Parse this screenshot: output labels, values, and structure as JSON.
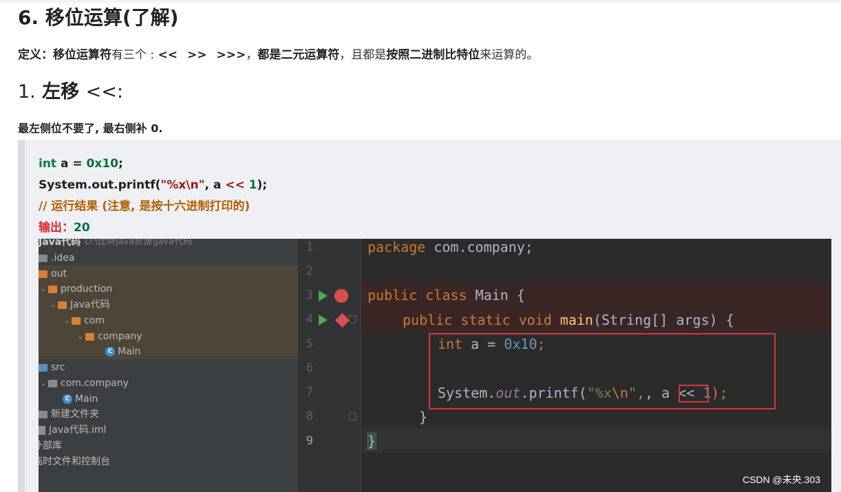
{
  "article": {
    "h2": "6. 移位运算(了解)",
    "definition": {
      "label": "定义",
      "colon": "：",
      "term": "移位运算符",
      "text1": "有三个 : ",
      "ops": [
        "<<",
        ">>",
        ">>>"
      ],
      "sep": "，",
      "strong2": "都是二元运算符",
      "text2": "，且都是",
      "strong3": "按照二进制比特位",
      "text3": "来运算的。"
    },
    "h3": {
      "num": "1.",
      "title": "左移",
      "op": "<<:"
    },
    "note": "最左侧位不要了, 最右侧补 0."
  },
  "code": {
    "l1": {
      "kw": "int",
      "rest": " a = ",
      "val": "0x10",
      "end": ";"
    },
    "l2": {
      "pre": "System.out.printf(",
      "str": "\"%x\\n\"",
      "mid": ", a ",
      "op": "<<",
      "num": " 1",
      "end": ");"
    },
    "l3": "// 运行结果 (注意, 是按十六进制打印的)",
    "l4": {
      "label": "输出：",
      "val": "20"
    }
  },
  "ide": {
    "project_tree": [
      {
        "label": "Java代码",
        "path": "D:\\比特java资源\\Java代码",
        "icon": "folder-icon"
      },
      {
        "label": ".idea",
        "icon": "folder-icon"
      },
      {
        "label": "out",
        "icon": "folder-icon"
      },
      {
        "label": "production",
        "icon": "folder-icon"
      },
      {
        "label": "Java代码",
        "icon": "folder-icon"
      },
      {
        "label": "com",
        "icon": "folder-icon"
      },
      {
        "label": "company",
        "icon": "folder-icon"
      },
      {
        "label": "Main",
        "icon": "java-class-icon"
      },
      {
        "label": "src",
        "icon": "folder-icon"
      },
      {
        "label": "com.company",
        "icon": "package-icon"
      },
      {
        "label": "Main",
        "icon": "java-class-icon"
      },
      {
        "label": "新建文件夹",
        "icon": "folder-icon"
      },
      {
        "label": "Java代码.iml",
        "icon": "file-icon"
      },
      {
        "label": "外部库",
        "icon": "library-icon"
      },
      {
        "label": "临时文件和控制台",
        "icon": "scratch-icon"
      }
    ],
    "line_numbers": [
      "1",
      "2",
      "3",
      "4",
      "5",
      "6",
      "7",
      "8",
      "9"
    ],
    "editor": {
      "l1_kw": "package",
      "l1_rest": " com.company;",
      "l3_kw": "public class",
      "l3_rest": " Main {",
      "l4_kw": "public static void",
      "l4_fn": " main",
      "l4_rest": "(String[] args) {",
      "l5_kw": "int",
      "l5_rest": " a = ",
      "l5_num": "0x10",
      "l5_end": ";",
      "l7_pre": "System.",
      "l7_field": "out",
      "l7_call": ".printf(",
      "l7_str": "\"%x",
      "l7_esc": "\\n",
      "l7_strend": "\"",
      "l7_mid": ", a ",
      "l7_op": "<<",
      "l7_num": " 1",
      "l7_end": ");",
      "l8": "}",
      "l9": "}"
    },
    "colors": {
      "keyword": "#cc7832",
      "number": "#6897bb",
      "string": "#6a8759",
      "highlight_box": "#e1313a"
    }
  },
  "watermark": "CSDN @未央.303"
}
